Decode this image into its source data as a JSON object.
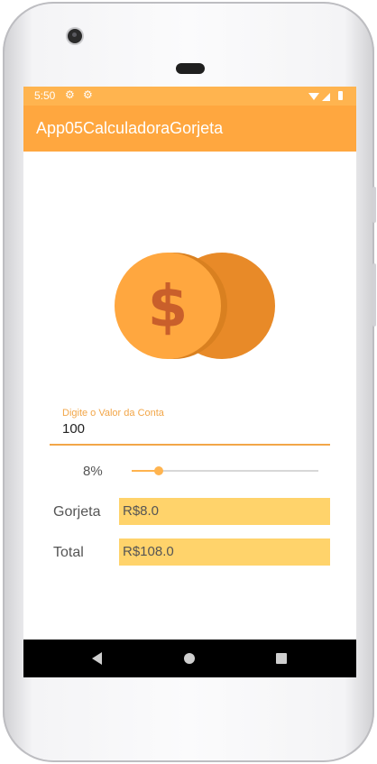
{
  "status_bar": {
    "time": "5:50",
    "icons": [
      "gear-icon",
      "gear-icon",
      "wifi-icon",
      "signal-icon",
      "battery-icon"
    ]
  },
  "app_bar": {
    "title": "App05CalculadoraGorjeta"
  },
  "colors": {
    "status_bar": "#ffb44f",
    "app_bar": "#ffa73f",
    "accent": "#f2a648",
    "value_box": "#ffd36b",
    "coin_front": "#ffa73f",
    "coin_back": "#e88a28",
    "dollar": "#c95f2b"
  },
  "logo": {
    "icon": "coins-dollar-icon",
    "symbol": "$"
  },
  "bill_field": {
    "label": "Digite o Valor da Conta",
    "value": "100"
  },
  "tip": {
    "percent_label": "8%",
    "slider_fraction": 0.08
  },
  "results": {
    "tip_label": "Gorjeta",
    "tip_value": "R$8.0",
    "total_label": "Total",
    "total_value": "R$108.0"
  },
  "nav_bar": {
    "icons": [
      "back-icon",
      "home-icon",
      "recents-icon"
    ]
  }
}
